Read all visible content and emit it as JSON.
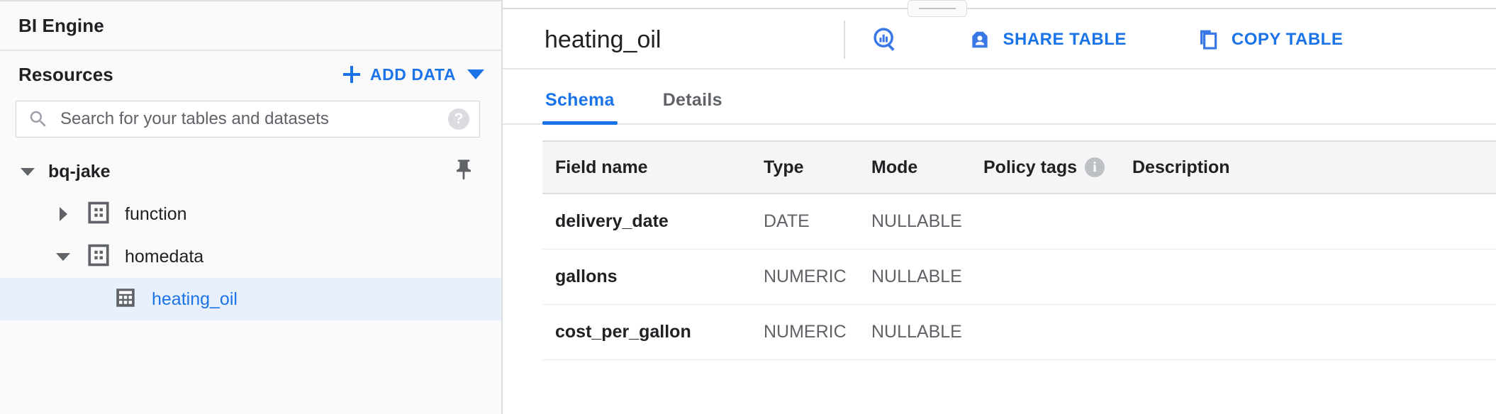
{
  "sidebar": {
    "bi_engine_title": "BI Engine",
    "resources_label": "Resources",
    "add_data_label": "ADD DATA",
    "search": {
      "placeholder": "Search for your tables and datasets",
      "value": "",
      "help_glyph": "?"
    },
    "tree": [
      {
        "label": "bq-jake",
        "level": 0,
        "expanded": true,
        "kind": "project",
        "selected": false,
        "pinned": true
      },
      {
        "label": "function",
        "level": 1,
        "expanded": false,
        "kind": "dataset",
        "selected": false
      },
      {
        "label": "homedata",
        "level": 1,
        "expanded": true,
        "kind": "dataset",
        "selected": false
      },
      {
        "label": "heating_oil",
        "level": 2,
        "expanded": null,
        "kind": "table",
        "selected": true
      }
    ]
  },
  "main": {
    "title": "heating_oil",
    "actions": {
      "query_table_label": "",
      "share_table_label": "SHARE TABLE",
      "copy_table_label": "COPY TABLE"
    },
    "tabs": [
      {
        "label": "Schema",
        "active": true
      },
      {
        "label": "Details",
        "active": false
      }
    ],
    "schema": {
      "columns": [
        "Field name",
        "Type",
        "Mode",
        "Policy tags",
        "Description"
      ],
      "policy_tags_info_glyph": "i",
      "rows": [
        {
          "field_name": "delivery_date",
          "type": "DATE",
          "mode": "NULLABLE",
          "policy_tags": "",
          "description": ""
        },
        {
          "field_name": "gallons",
          "type": "NUMERIC",
          "mode": "NULLABLE",
          "policy_tags": "",
          "description": ""
        },
        {
          "field_name": "cost_per_gallon",
          "type": "NUMERIC",
          "mode": "NULLABLE",
          "policy_tags": "",
          "description": ""
        }
      ]
    }
  },
  "colors": {
    "accent": "#1a73e8",
    "selected_row_bg": "#e8f0fe",
    "sidebar_bg": "#fafafa",
    "table_header_bg": "#f5f5f5",
    "text_primary": "#202124",
    "text_secondary": "#5f6368",
    "border": "#dadce0"
  }
}
